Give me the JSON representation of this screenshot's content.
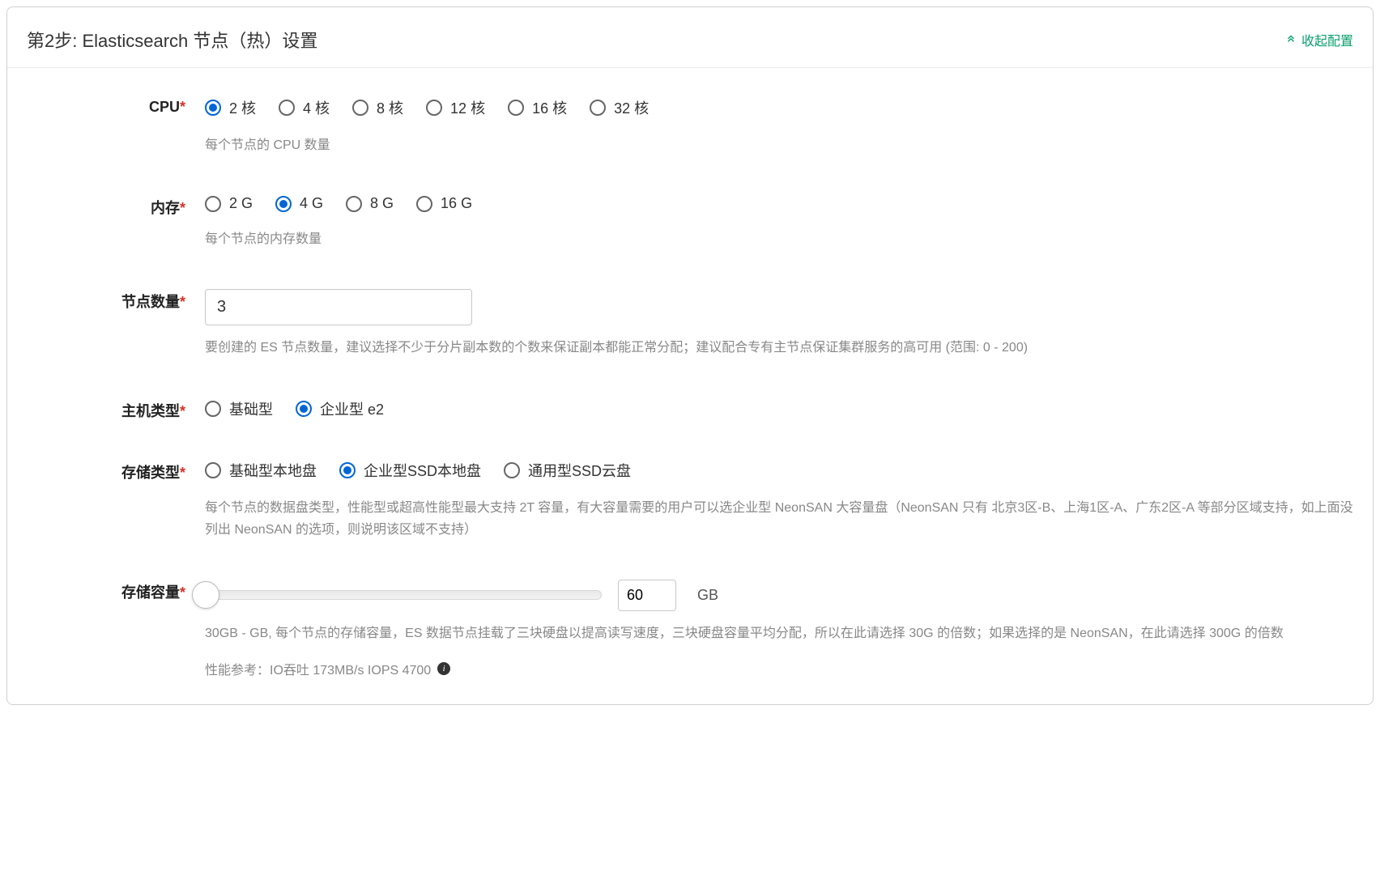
{
  "header": {
    "title": "第2步: Elasticsearch 节点（热）设置",
    "collapse_label": "收起配置"
  },
  "cpu": {
    "label": "CPU",
    "options": [
      "2 核",
      "4 核",
      "8 核",
      "12 核",
      "16 核",
      "32 核"
    ],
    "selected_index": 0,
    "help": "每个节点的 CPU 数量"
  },
  "memory": {
    "label": "内存",
    "options": [
      "2 G",
      "4 G",
      "8 G",
      "16 G"
    ],
    "selected_index": 1,
    "help": "每个节点的内存数量"
  },
  "node_count": {
    "label": "节点数量",
    "value": "3",
    "help": "要创建的 ES 节点数量，建议选择不少于分片副本数的个数来保证副本都能正常分配；建议配合专有主节点保证集群服务的高可用 (范围: 0 - 200)"
  },
  "host_type": {
    "label": "主机类型",
    "options": [
      "基础型",
      "企业型 e2"
    ],
    "selected_index": 1
  },
  "storage_type": {
    "label": "存储类型",
    "options": [
      "基础型本地盘",
      "企业型SSD本地盘",
      "通用型SSD云盘"
    ],
    "selected_index": 1,
    "help": "每个节点的数据盘类型，性能型或超高性能型最大支持 2T 容量，有大容量需要的用户可以选企业型 NeonSAN 大容量盘（NeonSAN 只有 北京3区-B、上海1区-A、广东2区-A 等部分区域支持，如上面没列出 NeonSAN 的选项，则说明该区域不支持）"
  },
  "storage_capacity": {
    "label": "存储容量",
    "value": "60",
    "unit": "GB",
    "help": "30GB - GB, 每个节点的存储容量，ES 数据节点挂载了三块硬盘以提高读写速度，三块硬盘容量平均分配，所以在此请选择 30G 的倍数；如果选择的是 NeonSAN，在此请选择 300G 的倍数",
    "perf_label": "性能参考：IO吞吐 173MB/s  IOPS 4700"
  }
}
